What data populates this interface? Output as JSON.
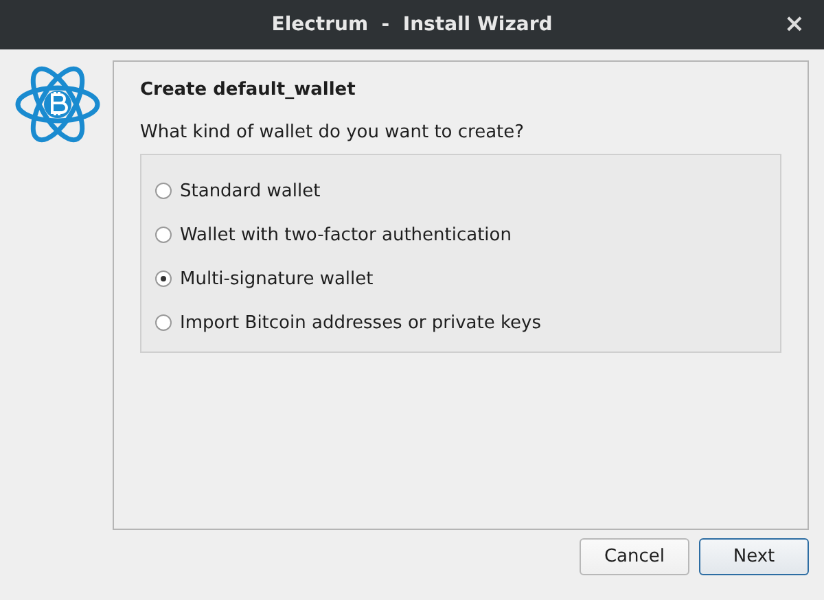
{
  "window": {
    "title": "Electrum  -  Install Wizard",
    "close": "×"
  },
  "heading": "Create default_wallet",
  "question": "What kind of wallet do you want to create?",
  "options": [
    {
      "label": "Standard wallet",
      "selected": false
    },
    {
      "label": "Wallet with two-factor authentication",
      "selected": false
    },
    {
      "label": "Multi-signature wallet",
      "selected": true
    },
    {
      "label": "Import Bitcoin addresses or private keys",
      "selected": false
    }
  ],
  "buttons": [
    {
      "label": "Cancel",
      "default": false
    },
    {
      "label": "Next",
      "default": true
    }
  ]
}
